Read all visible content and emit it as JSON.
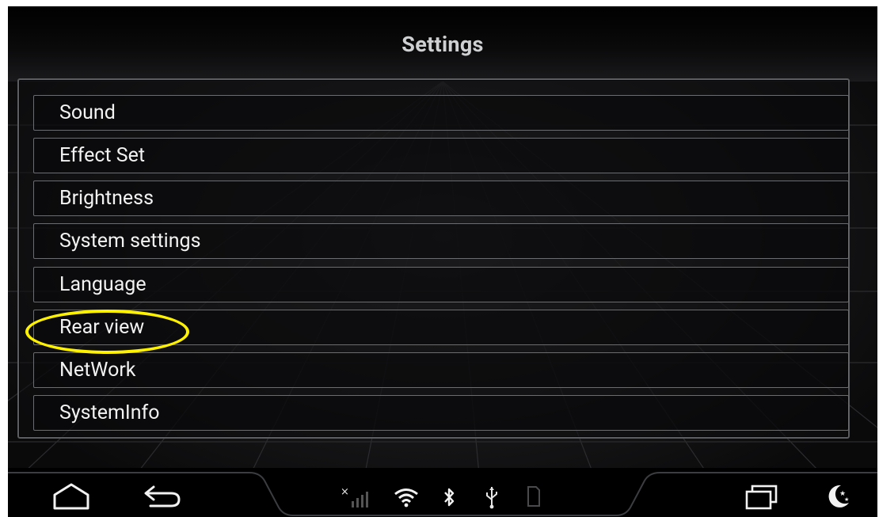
{
  "header": {
    "title": "Settings"
  },
  "menu": {
    "items": [
      {
        "label": "Sound"
      },
      {
        "label": "Effect Set"
      },
      {
        "label": "Brightness"
      },
      {
        "label": "System settings"
      },
      {
        "label": "Language"
      },
      {
        "label": "Rear view"
      },
      {
        "label": "NetWork"
      },
      {
        "label": "SystemInfo"
      }
    ]
  },
  "annotation": {
    "highlighted_item": "Rear view",
    "color": "#fff200"
  },
  "nav_bar": {
    "buttons": [
      "home-icon",
      "back-icon",
      "recent-apps-icon",
      "night-mode-icon"
    ],
    "status_icons": [
      "no-signal-icon",
      "wifi-icon",
      "bluetooth-icon",
      "usb-icon",
      "sd-card-icon"
    ]
  },
  "colors": {
    "background": "#0b0b0c",
    "text": "#f2f2f2",
    "border": "#6b6c70"
  }
}
